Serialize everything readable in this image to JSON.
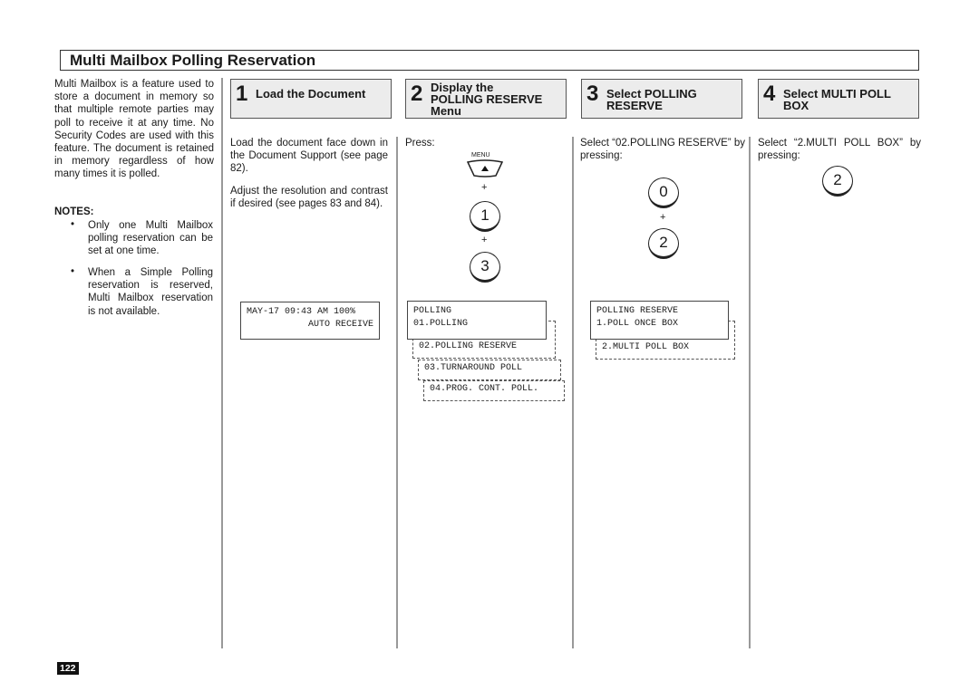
{
  "title": "Multi Mailbox Polling Reservation",
  "intro": "Multi Mailbox is a feature used to store a document in memory so that multiple remote parties may poll to receive it at any time. No Security Codes are used with this feature. The document is retained in memory regardless of how many times it is polled.",
  "notes": {
    "label": "NOTES:",
    "items": [
      "Only one Multi Mailbox polling reservation can be set at one time.",
      "When a Simple Polling reservation is reserved, Multi Mailbox reservation is not available."
    ],
    "bullet": "•"
  },
  "steps": [
    {
      "number": "1",
      "title_lines": [
        "Load the Document"
      ],
      "paragraphs": [
        "Load the document face down in the Document Support (see page 82).",
        "Adjust the resolution and contrast if desired (see pages 83 and 84)."
      ],
      "lcd": [
        "MAY-17 09:43 AM 100%",
        "AUTO RECEIVE"
      ]
    },
    {
      "number": "2",
      "title_lines": [
        "Display the",
        "POLLING RESERVE",
        "Menu"
      ],
      "instruction": "Press:",
      "menu_key_label": "MENU",
      "keys": [
        "1",
        "3"
      ],
      "plus": "+",
      "lcd": [
        "POLLING",
        "01.POLLING"
      ],
      "lcd_options": [
        "02.POLLING RESERVE",
        "03.TURNAROUND POLL",
        "04.PROG. CONT. POLL."
      ]
    },
    {
      "number": "3",
      "title_lines": [
        "Select POLLING",
        "RESERVE"
      ],
      "instruction": "Select “02.POLLING RESERVE” by pressing:",
      "keys": [
        "0",
        "2"
      ],
      "plus": "+",
      "lcd": [
        "POLLING RESERVE",
        "1.POLL ONCE BOX"
      ],
      "lcd_options": [
        "2.MULTI POLL BOX"
      ]
    },
    {
      "number": "4",
      "title_lines": [
        "Select MULTI POLL",
        "BOX"
      ],
      "instruction": "Select “2.MULTI POLL BOX” by pressing:",
      "keys": [
        "2"
      ]
    }
  ],
  "page_number": "122"
}
